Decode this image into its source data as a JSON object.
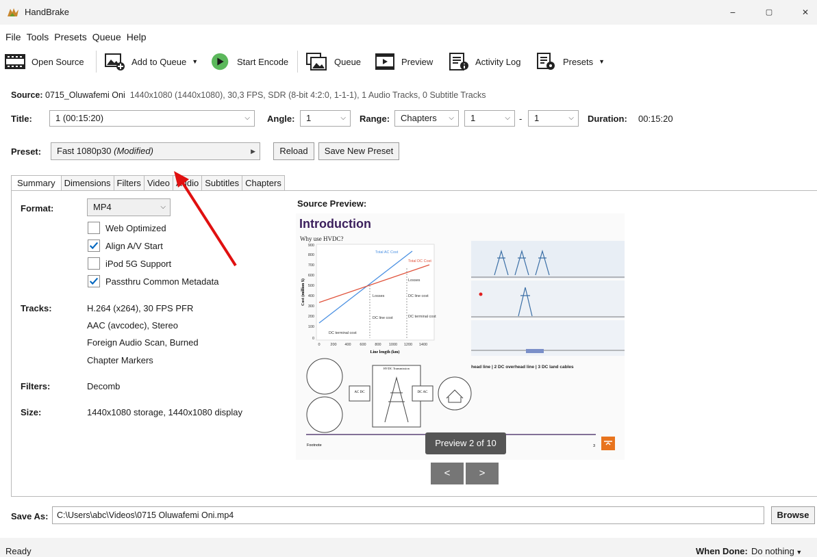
{
  "app": {
    "title": "HandBrake"
  },
  "window": {
    "minimize": "−",
    "maximize": "▢",
    "close": "✕"
  },
  "menu": [
    "File",
    "Tools",
    "Presets",
    "Queue",
    "Help"
  ],
  "toolbar": {
    "open_source": "Open Source",
    "add_to_queue": "Add to Queue",
    "start_encode": "Start Encode",
    "queue": "Queue",
    "preview": "Preview",
    "activity_log": "Activity Log",
    "presets": "Presets"
  },
  "source": {
    "label": "Source:",
    "name": "0715_Oluwafemi Oni",
    "details": "1440x1080 (1440x1080), 30,3 FPS, SDR (8-bit 4:2:0, 1-1-1), 1 Audio Tracks, 0 Subtitle Tracks"
  },
  "title_row": {
    "title_label": "Title:",
    "title_value": "1  (00:15:20)",
    "angle_label": "Angle:",
    "angle_value": "1",
    "range_label": "Range:",
    "range_value": "Chapters",
    "range_start": "1",
    "range_dash": "-",
    "range_end": "1",
    "duration_label": "Duration:",
    "duration_value": "00:15:20"
  },
  "preset": {
    "label": "Preset:",
    "value": "Fast 1080p30",
    "modified": "(Modified)",
    "reload": "Reload",
    "save_new": "Save New Preset"
  },
  "tabs": [
    "Summary",
    "Dimensions",
    "Filters",
    "Video",
    "Audio",
    "Subtitles",
    "Chapters"
  ],
  "summary": {
    "format_label": "Format:",
    "format_value": "MP4",
    "checks": [
      {
        "label": "Web Optimized",
        "checked": false
      },
      {
        "label": "Align A/V Start",
        "checked": true
      },
      {
        "label": "iPod 5G Support",
        "checked": false
      },
      {
        "label": "Passthru Common Metadata",
        "checked": true
      }
    ],
    "tracks_label": "Tracks:",
    "tracks": [
      "H.264 (x264), 30 FPS PFR",
      "AAC (avcodec), Stereo",
      "Foreign Audio Scan, Burned",
      "Chapter Markers"
    ],
    "filters_label": "Filters:",
    "filters_value": "Decomb",
    "size_label": "Size:",
    "size_value": "1440x1080 storage, 1440x1080 display"
  },
  "source_preview": {
    "heading": "Source Preview:",
    "slide": {
      "title": "Introduction",
      "subtitle": "Why use HVDC?",
      "chart_ylabel": "Cost (million $)",
      "chart_xlabel": "Line length (km)",
      "yticks": [
        "900",
        "800",
        "700",
        "600",
        "500",
        "400",
        "300",
        "200",
        "100",
        "0"
      ],
      "xticks": [
        "0",
        "200",
        "400",
        "600",
        "800",
        "1000",
        "1200",
        "1400"
      ],
      "total_ac": "Total AC Cost",
      "total_dc": "Total DC Cost",
      "losses_1": "Losses",
      "losses_2": "Losses",
      "dc_line_1": "DC line cost",
      "dc_line_2": "DC line cost",
      "dc_terminal_1": "DC terminal cost",
      "dc_terminal_2": "DC terminal cost",
      "right_caption": "head line | 2 DC overhead line | 3 DC land cables",
      "footnote": "Footnote",
      "page_num": "3",
      "ac_dc": "AC DC",
      "dc_ac": "DC AC",
      "hvdc_label": "HVDC Transmission"
    },
    "badge": "Preview 2 of 10",
    "prev": "<",
    "next": ">"
  },
  "save_as": {
    "label": "Save As:",
    "path": "C:\\Users\\abc\\Videos\\0715 Oluwafemi Oni.mp4",
    "browse": "Browse"
  },
  "status": {
    "text": "Ready",
    "when_done_label": "When Done:",
    "when_done_value": "Do nothing"
  },
  "colors": {
    "accent_green": "#5cb85c",
    "check_blue": "#0067c0",
    "arrow_red": "#e01010",
    "slide_title": "#3b1f5c",
    "ac_line": "#4a90e2",
    "dc_line": "#e0533c"
  }
}
